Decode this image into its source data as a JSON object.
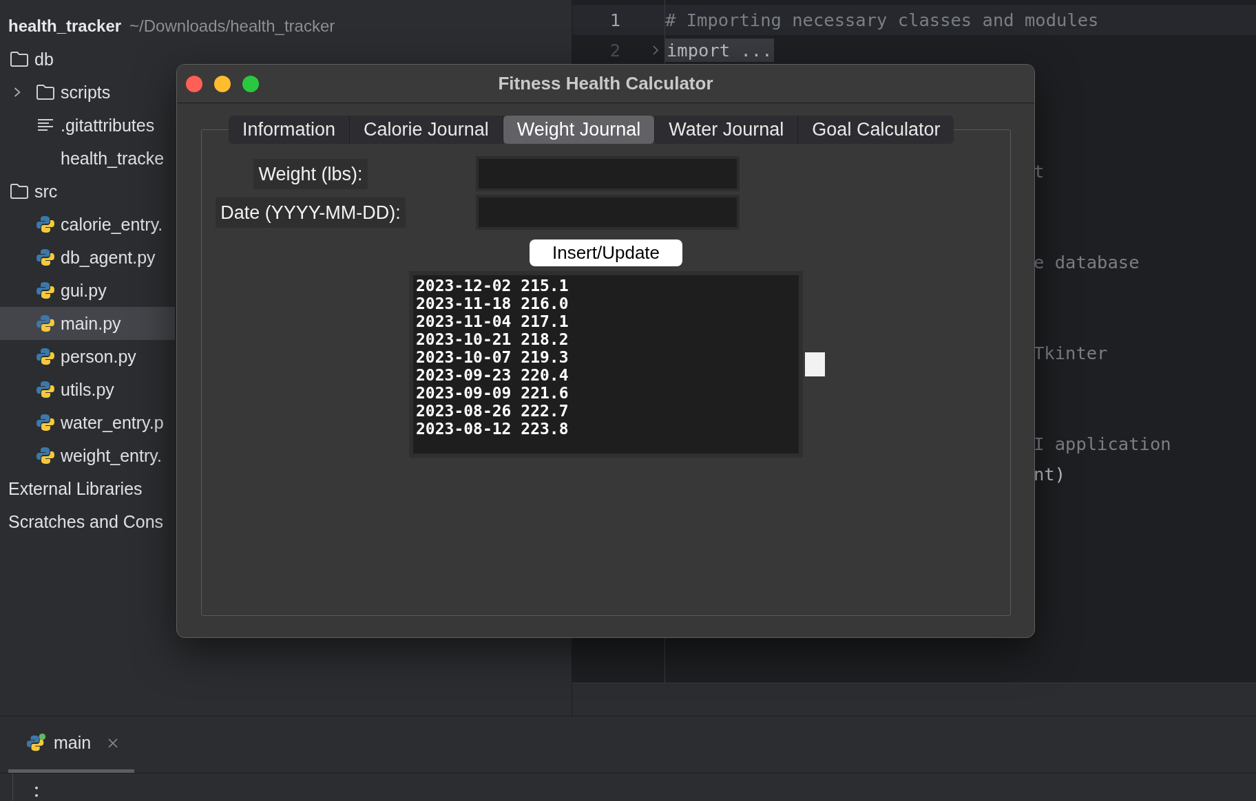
{
  "project": {
    "name": "health_tracker",
    "path": "~/Downloads/health_tracker"
  },
  "tree": [
    {
      "label": "db",
      "kind": "folder",
      "expanded": true,
      "selected": false,
      "children": [
        {
          "label": "scripts",
          "kind": "folder",
          "expanded": false,
          "selected": false
        },
        {
          "label": ".gitattributes",
          "kind": "text",
          "selected": false
        },
        {
          "label": "health_tracke",
          "kind": "plain",
          "selected": false
        }
      ]
    },
    {
      "label": "src",
      "kind": "folder",
      "expanded": true,
      "selected": false,
      "children": [
        {
          "label": "calorie_entry.",
          "kind": "python",
          "selected": false
        },
        {
          "label": "db_agent.py",
          "kind": "python",
          "selected": false
        },
        {
          "label": "gui.py",
          "kind": "python",
          "selected": false
        },
        {
          "label": "main.py",
          "kind": "python",
          "selected": true
        },
        {
          "label": "person.py",
          "kind": "python",
          "selected": false
        },
        {
          "label": "utils.py",
          "kind": "python",
          "selected": false
        },
        {
          "label": "water_entry.p",
          "kind": "python",
          "selected": false
        },
        {
          "label": "weight_entry.",
          "kind": "python",
          "selected": false
        }
      ]
    },
    {
      "label": "External Libraries",
      "kind": "library",
      "selected": false
    },
    {
      "label": "Scratches and Cons",
      "kind": "library",
      "selected": false
    }
  ],
  "editor": {
    "lines": [
      {
        "number": "1",
        "text": "# Importing necessary classes and modules",
        "kind": "comment",
        "current": true
      },
      {
        "number": "2",
        "text": "import ...",
        "kind": "folded",
        "current": false
      }
    ],
    "fragments": [
      {
        "text": "t",
        "kind": "comment"
      },
      {
        "text": "e database",
        "kind": "comment"
      },
      {
        "text": "Tkinter",
        "kind": "comment"
      },
      {
        "text": "I application",
        "kind": "comment"
      },
      {
        "text": "nt)",
        "kind": "code"
      }
    ]
  },
  "app_window": {
    "title": "Fitness Health Calculator",
    "tabs": [
      {
        "label": "Information",
        "selected": false
      },
      {
        "label": "Calorie Journal",
        "selected": false
      },
      {
        "label": "Weight Journal",
        "selected": true
      },
      {
        "label": "Water Journal",
        "selected": false
      },
      {
        "label": "Goal Calculator",
        "selected": false
      }
    ],
    "fields": [
      {
        "label": "Weight (lbs):"
      },
      {
        "label": "Date (YYYY-MM-DD):"
      }
    ],
    "button": "Insert/Update",
    "entries": [
      "2023-12-02 215.1",
      "2023-11-18 216.0",
      "2023-11-04 217.1",
      "2023-10-21 218.2",
      "2023-10-07 219.3",
      "2023-09-23 220.4",
      "2023-09-09 221.6",
      "2023-08-26 222.7",
      "2023-08-12 223.8"
    ]
  },
  "run_panel": {
    "tabs": [
      {
        "label": "main",
        "selected": true
      }
    ]
  }
}
